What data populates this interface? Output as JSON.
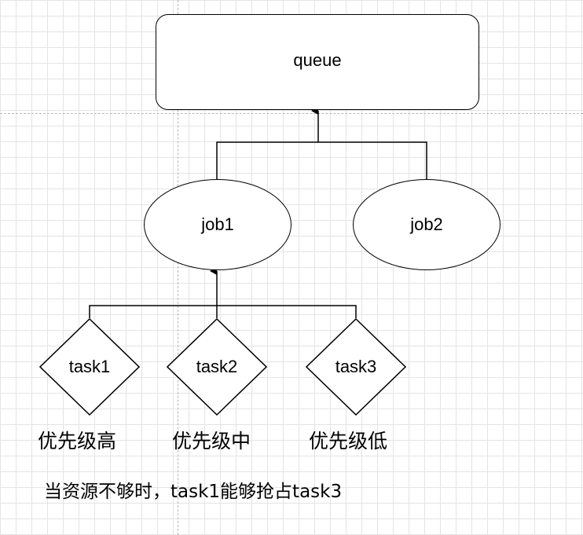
{
  "queue": {
    "label": "queue"
  },
  "jobs": [
    {
      "label": "job1"
    },
    {
      "label": "job2"
    }
  ],
  "tasks": [
    {
      "label": "task1",
      "priority": "优先级高"
    },
    {
      "label": "task2",
      "priority": "优先级中"
    },
    {
      "label": "task3",
      "priority": "优先级低"
    }
  ],
  "note": "当资源不够时，task1能够抢占task3",
  "colors": {
    "stroke": "#000000",
    "grid": "#e4e4e4",
    "guide": "#b8b8b8",
    "fill": "#ffffff"
  }
}
